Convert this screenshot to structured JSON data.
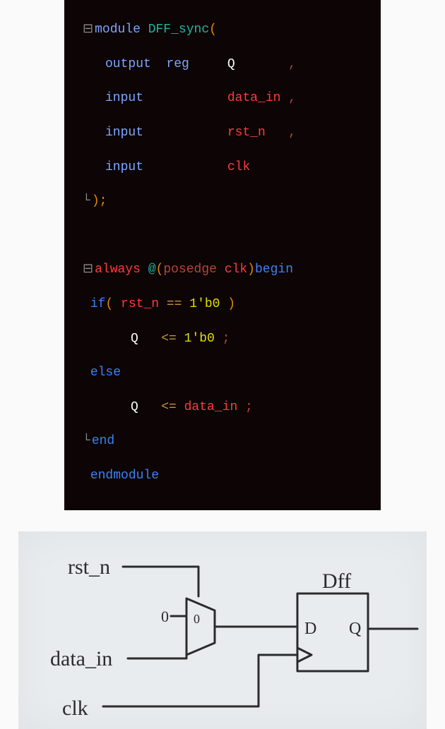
{
  "code": {
    "l1_module": "module",
    "l1_name": " DFF_sync",
    "l1_paren": "(",
    "l2_output": "output",
    "l2_reg": "  reg",
    "l2_Q": "Q",
    "l2_comma": ",",
    "l3_input": "input",
    "l3_sig": "data_in",
    "l3_comma": " ,",
    "l4_input": "input",
    "l4_sig": "rst_n",
    "l4_comma": ",",
    "l5_input": "input",
    "l5_sig": "clk",
    "l6_close": ");",
    "l8_always": "always",
    "l8_at": " @",
    "l8_po": "(",
    "l8_posedge": "posedge",
    "l8_clk": " clk",
    "l8_pc": ")",
    "l8_begin": "begin",
    "l9_if": "if",
    "l9_po": "(",
    "l9_rst": " rst_n ",
    "l9_eq": "== ",
    "l9_lit": "1'b0 ",
    "l9_pc": ")",
    "l10_Q": "Q",
    "l10_assign": "   <=",
    "l10_lit": " 1'b0 ",
    "l10_semi": ";",
    "l11_else": "else",
    "l12_Q": "Q",
    "l12_assign": "   <=",
    "l12_sig": " data_in ",
    "l12_semi": ";",
    "l13_end": "end",
    "l14_endmodule": "endmodule"
  },
  "sketch": {
    "rst_n": "rst_n",
    "data_in": "data_in",
    "clk": "clk",
    "dff": "Dff",
    "D": "D",
    "Q": "Q",
    "zero_top": "0",
    "zero_mid": "0"
  }
}
